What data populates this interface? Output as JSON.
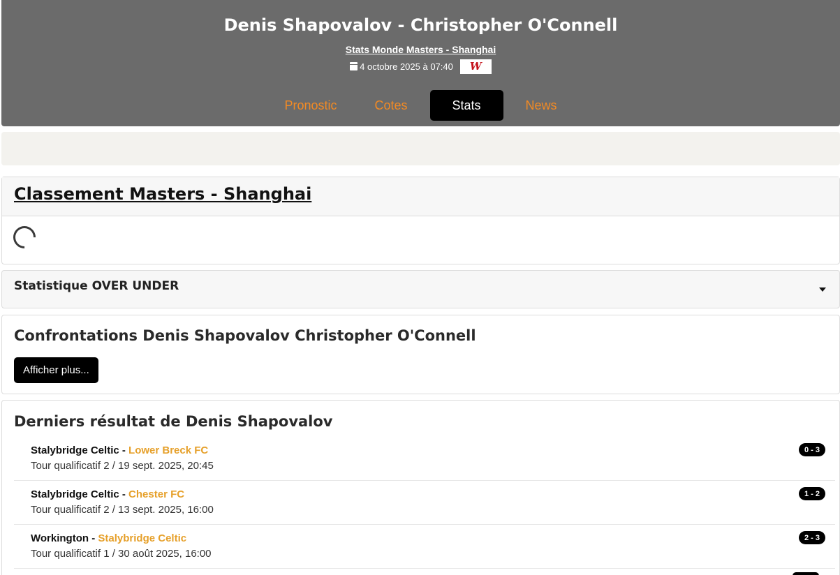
{
  "header": {
    "title": "Denis Shapovalov - Christopher O'Connell",
    "competition_link": "Stats Monde Masters - Shanghai",
    "date": "4 octobre 2025 à 07:40",
    "tv_logo_text": "W",
    "tabs": [
      {
        "label": "Pronostic",
        "active": false
      },
      {
        "label": "Cotes",
        "active": false
      },
      {
        "label": "Stats",
        "active": true
      },
      {
        "label": "News",
        "active": false
      }
    ]
  },
  "ranking": {
    "title": "Classement Masters - Shanghai"
  },
  "over_under": {
    "title": "Statistique OVER UNDER"
  },
  "head_to_head": {
    "title": "Confrontations Denis Shapovalov Christopher O'Connell",
    "more_label": "Afficher plus..."
  },
  "last_results": {
    "title": "Derniers résultat de Denis Shapovalov",
    "items": [
      {
        "home": "Stalybridge Celtic",
        "away": "Lower Breck FC",
        "meta": "Tour qualificatif 2 / 19 sept. 2025, 20:45",
        "score": "0 - 3"
      },
      {
        "home": "Stalybridge Celtic",
        "away": "Chester FC",
        "meta": "Tour qualificatif 2 / 13 sept. 2025, 16:00",
        "score": "1 - 2"
      },
      {
        "home": "Workington",
        "away": "Stalybridge Celtic",
        "meta": "Tour qualificatif 1 / 30 août 2025, 16:00",
        "score": "2 - 3"
      }
    ]
  },
  "colors": {
    "header_bg": "#6b6b6b",
    "accent_orange": "#f28a24",
    "away_team": "#e6a02a",
    "active_tab_bg": "#000000"
  }
}
